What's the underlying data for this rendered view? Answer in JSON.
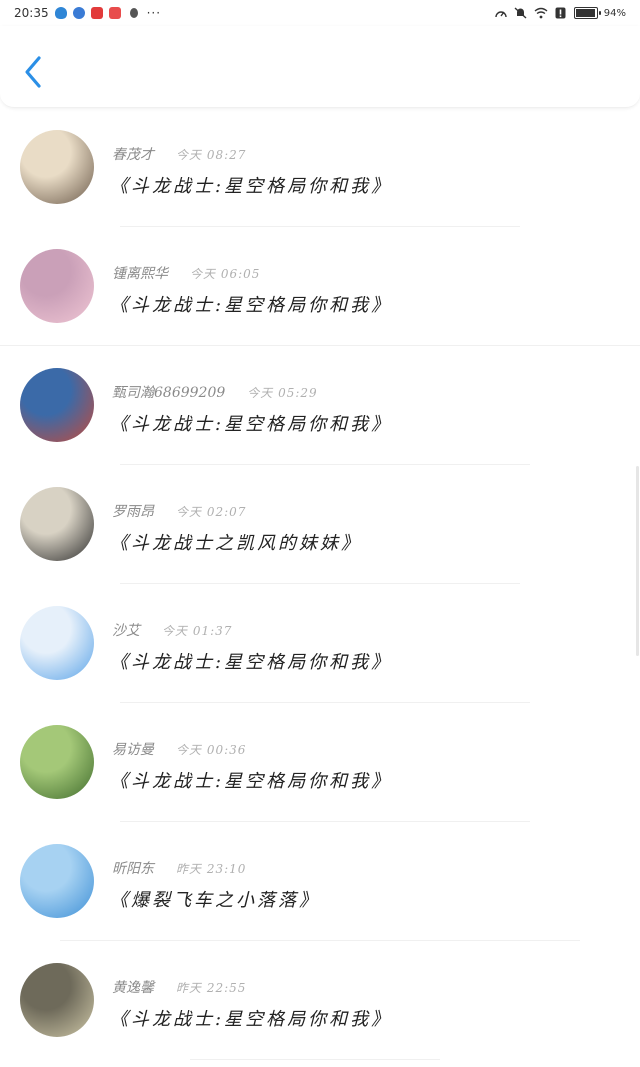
{
  "status_bar": {
    "time": "20:35",
    "apps": [
      {
        "name": "shield-app-icon",
        "color": "#2f86d6"
      },
      {
        "name": "browser-app-icon",
        "color": "#3a7bd5"
      },
      {
        "name": "red-app-icon",
        "color": "#e23b3b"
      },
      {
        "name": "red-app2-icon",
        "color": "#e84c4c"
      },
      {
        "name": "qq-icon",
        "color": "#555555"
      }
    ],
    "dots": "···",
    "battery_text": "94%",
    "battery_level": 0.94
  },
  "header": {
    "back_color": "#2b8fe6"
  },
  "comments": [
    {
      "name": "春茂才",
      "time": "今天 08:27",
      "book": "《斗龙战士:星空格局你和我》",
      "avatar_colors": [
        "#6b5a4a",
        "#e9dcc6"
      ]
    },
    {
      "name": "锺离熙华",
      "time": "今天 06:05",
      "book": "《斗龙战士:星空格局你和我》",
      "avatar_colors": [
        "#f0c6d4",
        "#caa0b8"
      ]
    },
    {
      "name": "甄司瀚68699209",
      "time": "今天 05:29",
      "book": "《斗龙战士:星空格局你和我》",
      "avatar_colors": [
        "#c44a3a",
        "#3b6aa8"
      ]
    },
    {
      "name": "罗雨昂",
      "time": "今天 02:07",
      "book": "《斗龙战士之凯风的妹妹》",
      "avatar_colors": [
        "#2b2b2b",
        "#d8d2c4"
      ]
    },
    {
      "name": "沙艾",
      "time": "今天 01:37",
      "book": "《斗龙战士:星空格局你和我》",
      "avatar_colors": [
        "#5aa3e8",
        "#e6f0fa"
      ]
    },
    {
      "name": "易访曼",
      "time": "今天 00:36",
      "book": "《斗龙战士:星空格局你和我》",
      "avatar_colors": [
        "#3f6b2c",
        "#a4c878"
      ]
    },
    {
      "name": "昕阳东",
      "time": "昨天 23:10",
      "book": "《爆裂飞车之小落落》",
      "avatar_colors": [
        "#3d8fd6",
        "#a7d2f2"
      ]
    },
    {
      "name": "黄逸馨",
      "time": "昨天 22:55",
      "book": "《斗龙战士:星空格局你和我》",
      "avatar_colors": [
        "#cfc8a8",
        "#6e6a5a"
      ]
    }
  ]
}
